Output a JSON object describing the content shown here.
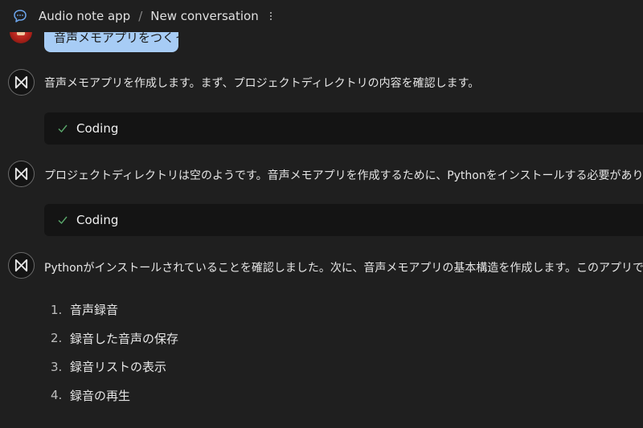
{
  "header": {
    "app_name": "Audio note app",
    "separator": "/",
    "conversation_title": "New conversation"
  },
  "user_message": {
    "text": "音声メモアプリをつくって"
  },
  "messages": [
    {
      "text": "音声メモアプリを作成します。まず、プロジェクトディレクトリの内容を確認します。"
    },
    {
      "text": "プロジェクトディレクトリは空のようです。音声メモアプリを作成するために、Pythonをインストールする必要があります。まず、Pythonがインストールされているか確認しましょう。"
    },
    {
      "text": "Pythonがインストールされていることを確認しました。次に、音声メモアプリの基本構造を作成します。このアプリでは以下の機能を実装します："
    }
  ],
  "tool_blocks": [
    {
      "label": "Coding"
    },
    {
      "label": "Coding"
    }
  ],
  "feature_list": [
    {
      "num": "1.",
      "text": "音声録音"
    },
    {
      "num": "2.",
      "text": "録音した音声の保存"
    },
    {
      "num": "3.",
      "text": "録音リストの表示"
    },
    {
      "num": "4.",
      "text": "録音の再生"
    }
  ],
  "colors": {
    "background": "#1f1f1f",
    "user_bubble": "#a7ccf5",
    "tool_block": "#141414",
    "check": "#5aa86b"
  }
}
